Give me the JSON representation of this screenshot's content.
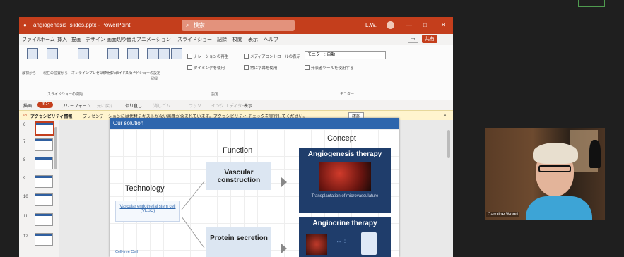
{
  "titlebar": {
    "doc_title": "angiogenesis_slides.pptx - PowerPoint",
    "search_placeholder": "検索",
    "user": "L.W.",
    "controls": [
      "—",
      "□",
      "✕"
    ]
  },
  "menubar": {
    "items": [
      "ファイル",
      "ホーム",
      "挿入",
      "描画",
      "デザイン",
      "画面切り替え",
      "アニメーション",
      "スライドショー",
      "記録",
      "校閲",
      "表示",
      "ヘルプ"
    ],
    "share_label": "共有"
  },
  "ribbon": {
    "buttons": [
      "最初から",
      "現在の位置から",
      "オンラインプレゼンテーション",
      "目的別スライドショー",
      "スライドショーの設定",
      "非表示スライド",
      "リハーサル",
      "記録",
      "録画"
    ],
    "checks": [
      "ナレーションの再生",
      "タイミングを使用",
      "メディアコントロールの表示",
      "常に字幕を使用",
      "字幕の設定"
    ],
    "monitor_label": "モニター: 自動",
    "presenter_label": "発表者ツールを使用する",
    "groups": [
      "スライドショーの開始",
      "設定",
      "モニター"
    ]
  },
  "inkbar": {
    "label": "描画",
    "toggle": "オン",
    "tools": [
      "フリーフォーム",
      "元に戻す",
      "やり直し",
      "消しゴム",
      "ラッソ",
      "インク エディター",
      "表示"
    ]
  },
  "warning": {
    "title": "アクセシビリティ情報",
    "text": "プレゼンテーションには代替テキストがない画像が含まれています。アクセシビリティ チェックを実行してください。",
    "action": "確認",
    "close": "✕"
  },
  "thumbnails": [
    "6",
    "7",
    "8",
    "9",
    "10",
    "11",
    "12"
  ],
  "slide": {
    "header": "Our solution",
    "concept": "Concept",
    "function": "Function",
    "technology": "Technology",
    "tech_box": "Vascular endothelial stem cell (VESC)",
    "tech_box2": "Cell-free Cell",
    "func1": "Vascular construction",
    "func2": "Protein secretion",
    "concept1_title": "Angiogenesis therapy",
    "concept1_sub": "-Transplantation of microvasculature-",
    "concept2_title": "Angiocrine therapy"
  },
  "video": {
    "participant_name": "Caroline Wood"
  }
}
